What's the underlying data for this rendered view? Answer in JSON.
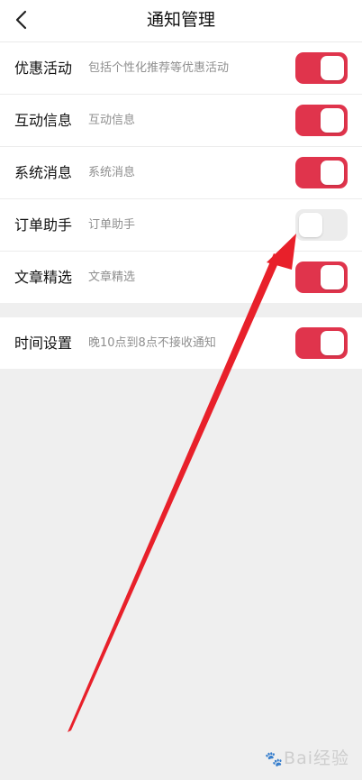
{
  "header": {
    "title": "通知管理",
    "back_icon": "chevron-left-icon"
  },
  "settings": [
    {
      "label": "优惠活动",
      "desc": "包括个性化推荐等优惠活动",
      "on": true
    },
    {
      "label": "互动信息",
      "desc": "互动信息",
      "on": true
    },
    {
      "label": "系统消息",
      "desc": "系统消息",
      "on": true
    },
    {
      "label": "订单助手",
      "desc": "订单助手",
      "on": false
    },
    {
      "label": "文章精选",
      "desc": "文章精选",
      "on": true
    }
  ],
  "time_setting": {
    "label": "时间设置",
    "desc": "晚10点到8点不接收通知",
    "on": true
  },
  "colors": {
    "toggle_on": "#e0344c",
    "toggle_off": "#ececec",
    "annotation_arrow": "#e8202a"
  },
  "watermark": {
    "text": "Bai经验",
    "icon": "paw-icon"
  }
}
